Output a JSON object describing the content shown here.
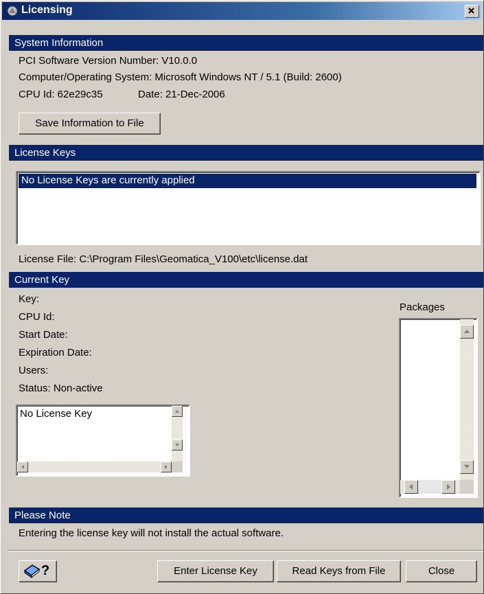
{
  "window": {
    "title": "Licensing",
    "close_label": "×"
  },
  "system_info": {
    "header": "System Information",
    "version": "PCI Software Version Number: V10.0.0",
    "os": "Computer/Operating System: Microsoft Windows NT / 5.1 (Build: 2600)",
    "cpu_id": "CPU Id: 62e29c35",
    "date": "Date: 21-Dec-2006",
    "save_button": "Save Information to File"
  },
  "license_keys": {
    "header": "License Keys",
    "items": [
      "No License Keys are currently applied"
    ],
    "license_file": "License File: C:\\Program Files\\Geomatica_V100\\etc\\license.dat"
  },
  "current_key": {
    "header": "Current Key",
    "fields": [
      "Key:",
      "CPU Id:",
      "Start Date:",
      "Expiration Date:",
      "Users:",
      "Status: Non-active"
    ],
    "key_text": "No License Key",
    "packages_label": "Packages"
  },
  "note": {
    "header": "Please Note",
    "text": "Entering the license key will not install the actual software."
  },
  "footer": {
    "enter_button": "Enter License Key",
    "read_button": "Read Keys from File",
    "close_button": "Close",
    "help_glyph": "?"
  },
  "icons": {
    "title": "licensing-app-icon",
    "help": "help-book-icon"
  },
  "colors": {
    "header_bg": "#0a246a",
    "window_bg": "#d4d0c8",
    "selection": "#0a246a"
  }
}
